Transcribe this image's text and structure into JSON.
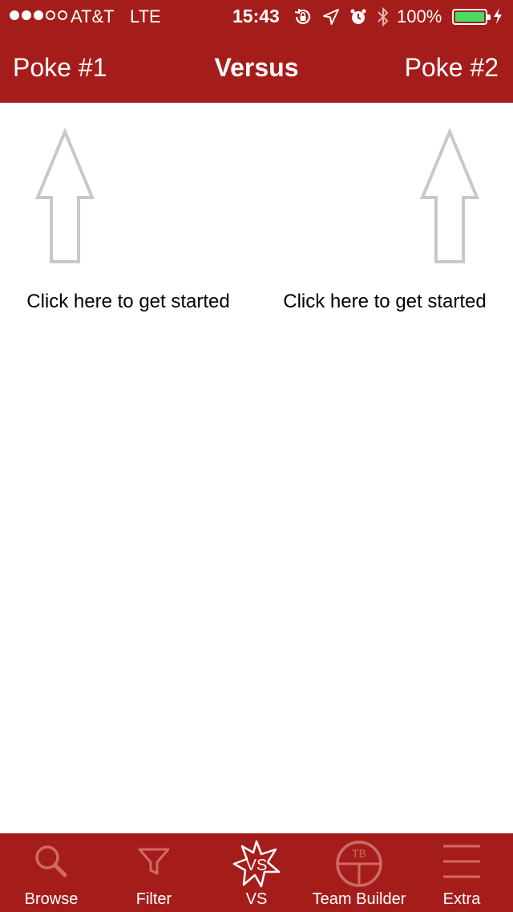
{
  "status_bar": {
    "carrier": "AT&T",
    "network": "LTE",
    "time": "15:43",
    "battery": "100%",
    "signal_bars_filled": 3,
    "signal_bars_total": 5,
    "icons": [
      "orientation-lock-icon",
      "location-icon",
      "alarm-icon",
      "bluetooth-icon",
      "battery-icon",
      "charging-icon"
    ]
  },
  "nav": {
    "left_label": "Poke #1",
    "title": "Versus",
    "right_label": "Poke #2"
  },
  "content": {
    "slot_1_caption": "Click here to get started",
    "slot_2_caption": "Click here to get started",
    "arrow_icon": "up-arrow-icon"
  },
  "tabbar": {
    "tabs": [
      {
        "label": "Browse",
        "icon": "magnifier-icon"
      },
      {
        "label": "Filter",
        "icon": "funnel-icon"
      },
      {
        "label": "VS",
        "icon": "vs-starburst-icon",
        "icon_text": "VS",
        "selected": true
      },
      {
        "label": "Team Builder",
        "icon": "pokeball-tb-icon",
        "icon_text": "TB"
      },
      {
        "label": "Extra",
        "icon": "hamburger-icon"
      }
    ]
  },
  "colors": {
    "brand_red": "#a51d1b",
    "arrow_gray": "#c8c8c8",
    "inactive_icon": "#d06a67",
    "battery_green": "#4cd964"
  }
}
